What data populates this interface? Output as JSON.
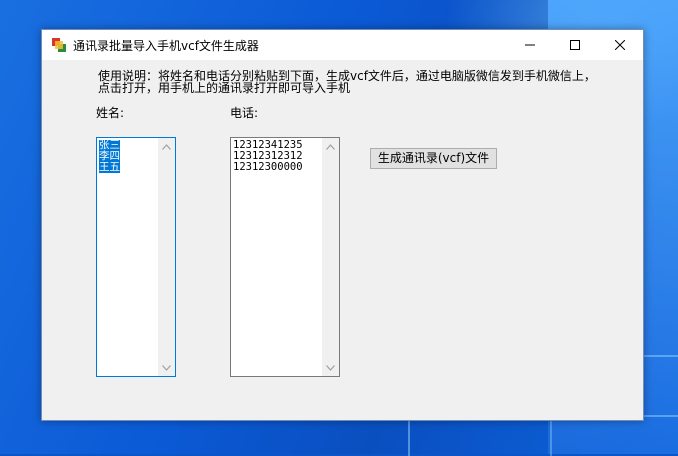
{
  "window": {
    "title": "通讯录批量导入手机vcf文件生成器"
  },
  "instructions": {
    "line1": "使用说明：将姓名和电话分别粘贴到下面，生成vcf文件后，通过电脑版微信发到手机微信上，",
    "line2": "点击打开，用手机上的通讯录打开即可导入手机"
  },
  "labels": {
    "name": "姓名:",
    "phone": "电话:"
  },
  "names": [
    "张三",
    "李四",
    "王五"
  ],
  "phones": [
    "12312341235",
    "12312312312",
    "12312300000"
  ],
  "buttons": {
    "generate": "生成通讯录(vcf)文件"
  },
  "colors": {
    "selection": "#0078d7",
    "window_bg": "#f0f0f0",
    "desktop": "#0b5ad6"
  },
  "icons": [
    "app-icon",
    "minimize-icon",
    "maximize-icon",
    "close-icon",
    "scroll-up-icon",
    "scroll-down-icon"
  ]
}
